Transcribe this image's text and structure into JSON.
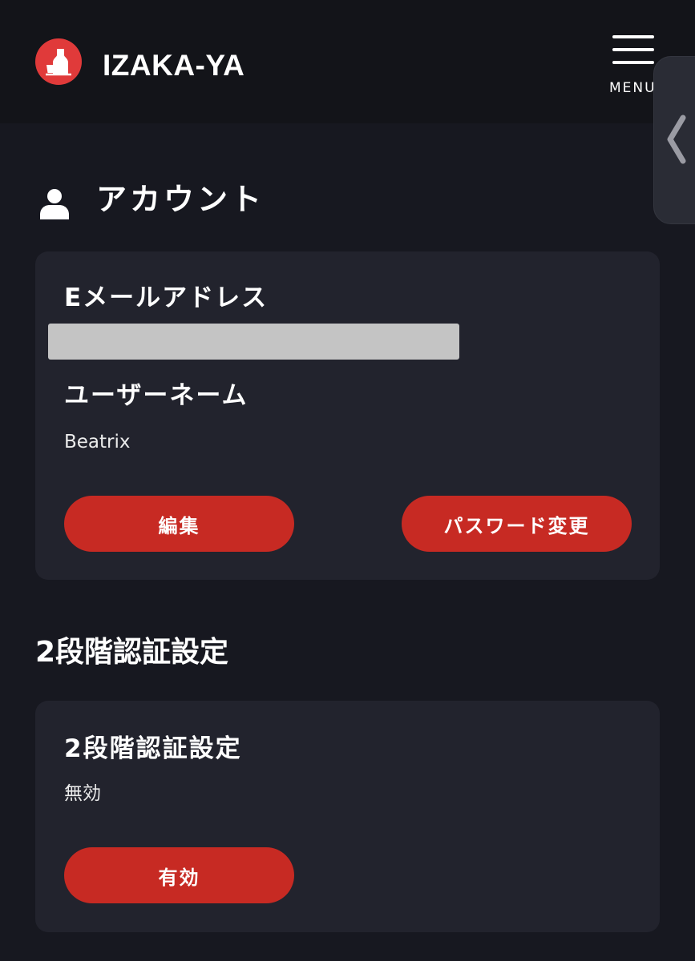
{
  "header": {
    "brand": "IZAKA-YA",
    "menu_label": "MENU",
    "brand_color": "#e03a3a"
  },
  "account": {
    "heading": "アカウント",
    "email_label": "Eメールアドレス",
    "email_value": "",
    "username_label": "ユーザーネーム",
    "username_value": "Beatrix",
    "edit_button": "編集",
    "password_button": "パスワード変更"
  },
  "two_factor": {
    "section_title": "2段階認証設定",
    "card_label": "2段階認証設定",
    "status": "無効",
    "enable_button": "有効"
  },
  "colors": {
    "background": "#171820",
    "header": "#131419",
    "card": "#22232d",
    "button": "#c72a23"
  },
  "icons": {
    "logo": "sake-bottle-icon",
    "menu": "hamburger-icon",
    "side_tab": "chevron-left-icon",
    "account": "user-icon"
  }
}
